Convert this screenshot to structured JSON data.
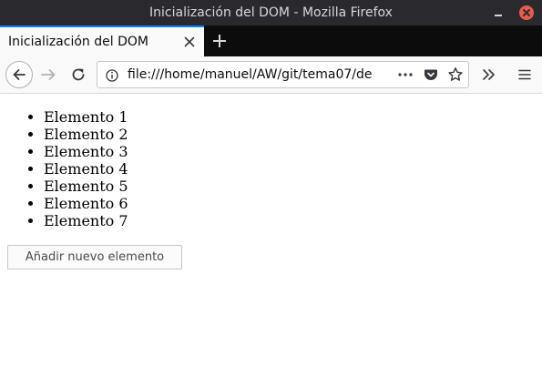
{
  "window": {
    "title": "Inicialización del DOM - Mozilla Firefox",
    "minimize_icon": "minimize-icon",
    "close_icon": "close-icon"
  },
  "tabs": [
    {
      "label": "Inicialización del DOM",
      "active": true,
      "close_icon": "close-icon"
    }
  ],
  "new_tab_icon": "plus-icon",
  "navigation": {
    "back_icon": "arrow-left-icon",
    "forward_icon": "arrow-right-icon",
    "reload_icon": "reload-icon",
    "url": "file:///home/manuel/AW/git/tema07/de",
    "info_icon": "info-icon",
    "page_actions_icon": "more-horizontal-icon",
    "pocket_icon": "pocket-icon",
    "bookmark_icon": "star-icon",
    "overflow_icon": "chevrons-right-icon",
    "menu_icon": "hamburger-menu-icon"
  },
  "page": {
    "items": [
      "Elemento 1",
      "Elemento 2",
      "Elemento 3",
      "Elemento 4",
      "Elemento 5",
      "Elemento 6",
      "Elemento 7"
    ],
    "add_button_label": "Añadir nuevo elemento"
  },
  "colors": {
    "titlebar_bg": "#2a2a2e",
    "tabstrip_bg": "#0c0c0d",
    "active_tab_accent": "#0a84ff",
    "window_close": "#e95b4c",
    "toolbar_bg": "#f9f9fa"
  }
}
